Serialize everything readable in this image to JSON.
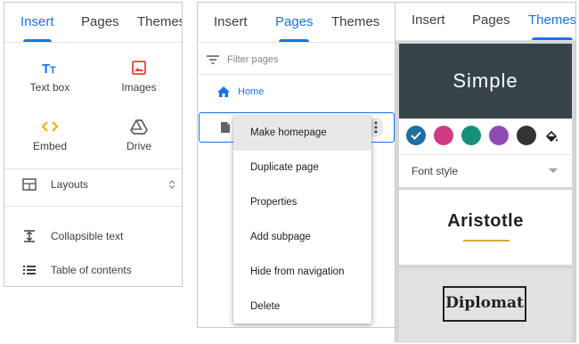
{
  "panel_insert": {
    "tabs": [
      {
        "label": "Insert",
        "active": true
      },
      {
        "label": "Pages",
        "active": false
      },
      {
        "label": "Themes",
        "active": false
      }
    ],
    "items": [
      {
        "label": "Text box",
        "icon": "text-box-icon",
        "color": "#1a73e8"
      },
      {
        "label": "Images",
        "icon": "image-icon",
        "color": "#ea4335"
      },
      {
        "label": "Embed",
        "icon": "embed-icon",
        "color": "#f9ab00"
      },
      {
        "label": "Drive",
        "icon": "drive-icon",
        "color": "#5f6368"
      }
    ],
    "layouts_label": "Layouts",
    "collapsible_label": "Collapsible text",
    "toc_label": "Table of contents"
  },
  "panel_pages": {
    "tabs": [
      {
        "label": "Insert",
        "active": false
      },
      {
        "label": "Pages",
        "active": true
      },
      {
        "label": "Themes",
        "active": false
      }
    ],
    "filter_placeholder": "Filter pages",
    "home_label": "Home",
    "menu": [
      "Make homepage",
      "Duplicate page",
      "Properties",
      "Add subpage",
      "Hide from navigation",
      "Delete"
    ]
  },
  "panel_themes": {
    "tabs": [
      {
        "label": "Insert",
        "active": false
      },
      {
        "label": "Pages",
        "active": false
      },
      {
        "label": "Themes",
        "active": true
      }
    ],
    "theme_simple": "Simple",
    "swatches": [
      "#1f6fa3",
      "#d13a82",
      "#16907a",
      "#8e4cb3",
      "#333333"
    ],
    "selected_swatch": 0,
    "font_style_label": "Font style",
    "theme_aristotle": "Aristotle",
    "theme_diplomat": "Diplomat",
    "accent": "#d4a843"
  }
}
